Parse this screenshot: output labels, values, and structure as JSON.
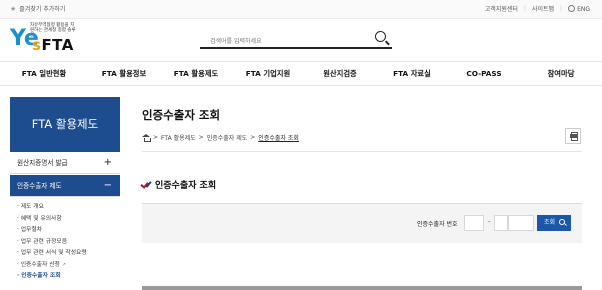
{
  "topbar": {
    "favorite": "즐겨찾기 추가하기",
    "util_links": [
      "고객지원센터",
      "사이트맵",
      "ENG"
    ]
  },
  "logo": {
    "tagline": "자유무역협정 활용을 지원하는 관세청 종합 솔루션",
    "ye": "Ye",
    "s": "s",
    "fta": "FTA"
  },
  "search": {
    "placeholder": "검색어를 입력하세요"
  },
  "gnb": [
    "FTA 일반현황",
    "FTA 활용정보",
    "FTA 활용제도",
    "FTA 기업지원",
    "원산지검증",
    "FTA 자료실",
    "CO-PASS",
    "참여마당"
  ],
  "lnb": {
    "title": "FTA 활용제도",
    "item1": "원산지증명서 발급",
    "item1_toggle": "+",
    "item2": "인증수출자 제도",
    "item2_toggle": "−",
    "sub": [
      "제도 개요",
      "혜택 및 유의사항",
      "업무절차",
      "업무 관련 규정모음",
      "업무 관련 서식 및 작성요령",
      "인증수출자 신청",
      "인증수출자 조회"
    ]
  },
  "content": {
    "title": "인증수출자 조회",
    "breadcrumb": [
      "FTA 활용제도",
      "인증수출자 제도",
      "인증수출자 조회"
    ],
    "section_title": "인증수출자 조회",
    "search_label": "인증수출자 번호",
    "search_button": "조회"
  }
}
